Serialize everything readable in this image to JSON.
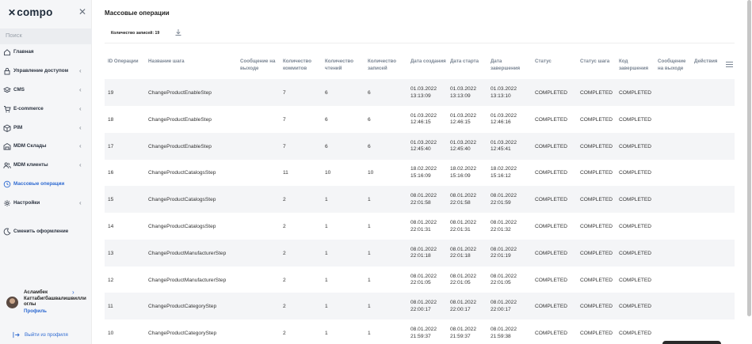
{
  "sidebar": {
    "logo": "compo",
    "search_placeholder": "Поиск",
    "items": [
      {
        "label": "Главная",
        "icon": "home-icon",
        "has_chevron": false
      },
      {
        "label": "Управление доступом",
        "icon": "lock-icon",
        "has_chevron": true
      },
      {
        "label": "CMS",
        "icon": "layers-icon",
        "has_chevron": true
      },
      {
        "label": "E-commerce",
        "icon": "cart-icon",
        "has_chevron": true
      },
      {
        "label": "PIM",
        "icon": "box-icon",
        "has_chevron": true
      },
      {
        "label": "MDM Склады",
        "icon": "warehouse-icon",
        "has_chevron": true
      },
      {
        "label": "MDM клиенты",
        "icon": "users-icon",
        "has_chevron": true
      },
      {
        "label": "Массовые операции",
        "icon": "clock-icon",
        "has_chevron": false,
        "active": true
      },
      {
        "label": "Настройки",
        "icon": "gear-icon",
        "has_chevron": true
      }
    ],
    "theme_toggle": "Сменить оформление",
    "user": {
      "name": "Асламбек Каттабигбашвалишвилли оглы",
      "profile": "Профиль"
    },
    "logout": "Выйти из профиля"
  },
  "main": {
    "title": "Массовые операции",
    "toolbar": {
      "count_label": "Количество записей: 19"
    },
    "columns": [
      "ID Операции",
      "Название шага",
      "Сообщение на выходе",
      "Количество коммитов",
      "Количество чтений",
      "Количество записей",
      "Дата создания",
      "Дата старта",
      "Дата завершения",
      "Статус",
      "Статус шага",
      "Код завершения",
      "Сообщение на выходе",
      "Действия"
    ],
    "rows": [
      {
        "id": "19",
        "step": "ChangeProductEnableStep",
        "commits": "7",
        "reads": "6",
        "writes": "6",
        "created": [
          "01.03.2022",
          "13:13:09"
        ],
        "started": [
          "01.03.2022",
          "13:13:09"
        ],
        "finished": [
          "01.03.2022",
          "13:13:10"
        ],
        "status": "COMPLETED",
        "step_status": "COMPLETED",
        "exit_code": "COMPLETED"
      },
      {
        "id": "18",
        "step": "ChangeProductEnableStep",
        "commits": "7",
        "reads": "6",
        "writes": "6",
        "created": [
          "01.03.2022",
          "12:46:15"
        ],
        "started": [
          "01.03.2022",
          "12:46:15"
        ],
        "finished": [
          "01.03.2022",
          "12:46:16"
        ],
        "status": "COMPLETED",
        "step_status": "COMPLETED",
        "exit_code": "COMPLETED"
      },
      {
        "id": "17",
        "step": "ChangeProductEnableStep",
        "commits": "7",
        "reads": "6",
        "writes": "6",
        "created": [
          "01.03.2022",
          "12:45:40"
        ],
        "started": [
          "01.03.2022",
          "12:45:40"
        ],
        "finished": [
          "01.03.2022",
          "12:45:41"
        ],
        "status": "COMPLETED",
        "step_status": "COMPLETED",
        "exit_code": "COMPLETED"
      },
      {
        "id": "16",
        "step": "ChangeProductCatalogsStep",
        "commits": "11",
        "reads": "10",
        "writes": "10",
        "created": [
          "18.02.2022",
          "15:16:09"
        ],
        "started": [
          "18.02.2022",
          "15:16:09"
        ],
        "finished": [
          "18.02.2022",
          "15:16:12"
        ],
        "status": "COMPLETED",
        "step_status": "COMPLETED",
        "exit_code": "COMPLETED"
      },
      {
        "id": "15",
        "step": "ChangeProductCatalogsStep",
        "commits": "2",
        "reads": "1",
        "writes": "1",
        "created": [
          "08.01.2022",
          "22:01:58"
        ],
        "started": [
          "08.01.2022",
          "22:01:58"
        ],
        "finished": [
          "08.01.2022",
          "22:01:59"
        ],
        "status": "COMPLETED",
        "step_status": "COMPLETED",
        "exit_code": "COMPLETED"
      },
      {
        "id": "14",
        "step": "ChangeProductCatalogsStep",
        "commits": "2",
        "reads": "1",
        "writes": "1",
        "created": [
          "08.01.2022",
          "22:01:31"
        ],
        "started": [
          "08.01.2022",
          "22:01:31"
        ],
        "finished": [
          "08.01.2022",
          "22:01:32"
        ],
        "status": "COMPLETED",
        "step_status": "COMPLETED",
        "exit_code": "COMPLETED"
      },
      {
        "id": "13",
        "step": "ChangeProductManufacturerStep",
        "commits": "2",
        "reads": "1",
        "writes": "1",
        "created": [
          "08.01.2022",
          "22:01:18"
        ],
        "started": [
          "08.01.2022",
          "22:01:18"
        ],
        "finished": [
          "08.01.2022",
          "22:01:19"
        ],
        "status": "COMPLETED",
        "step_status": "COMPLETED",
        "exit_code": "COMPLETED"
      },
      {
        "id": "12",
        "step": "ChangeProductManufacturerStep",
        "commits": "2",
        "reads": "1",
        "writes": "1",
        "created": [
          "08.01.2022",
          "22:01:05"
        ],
        "started": [
          "08.01.2022",
          "22:01:05"
        ],
        "finished": [
          "08.01.2022",
          "22:01:05"
        ],
        "status": "COMPLETED",
        "step_status": "COMPLETED",
        "exit_code": "COMPLETED"
      },
      {
        "id": "11",
        "step": "ChangeProductCategoryStep",
        "commits": "2",
        "reads": "1",
        "writes": "1",
        "created": [
          "08.01.2022",
          "22:00:17"
        ],
        "started": [
          "08.01.2022",
          "22:00:17"
        ],
        "finished": [
          "08.01.2022",
          "22:00:17"
        ],
        "status": "COMPLETED",
        "step_status": "COMPLETED",
        "exit_code": "COMPLETED"
      },
      {
        "id": "10",
        "step": "ChangeProductCategoryStep",
        "commits": "2",
        "reads": "1",
        "writes": "1",
        "created": [
          "08.01.2022",
          "21:59:37"
        ],
        "started": [
          "08.01.2022",
          "21:59:37"
        ],
        "finished": [
          "08.01.2022",
          "21:59:38"
        ],
        "status": "COMPLETED",
        "step_status": "COMPLETED",
        "exit_code": "COMPLETED"
      }
    ]
  },
  "colors": {
    "accent": "#2e6ad1",
    "sidebar_bg": "#f5f6f8",
    "row_stripe": "#f4f5f7",
    "header_text": "#7b8694"
  }
}
